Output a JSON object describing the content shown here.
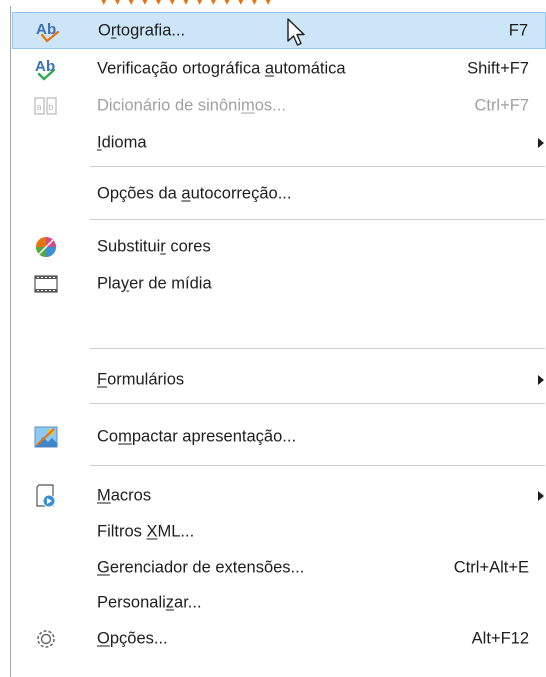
{
  "menu": {
    "items": [
      {
        "label_pre": "O",
        "label_u": "r",
        "label_post": "tografia...",
        "shortcut": "F7",
        "icon": "spelling-check-icon",
        "highlighted": true,
        "disabled": false
      },
      {
        "label_pre": "Verificação ortográfica ",
        "label_u": "a",
        "label_post": "utomática",
        "shortcut": "Shift+F7",
        "icon": "auto-spellcheck-icon",
        "disabled": false
      },
      {
        "label_pre": "Dicionário de sinôni",
        "label_u": "m",
        "label_post": "os...",
        "shortcut": "Ctrl+F7",
        "icon": "thesaurus-icon",
        "disabled": true
      },
      {
        "label_pre": "",
        "label_u": "I",
        "label_post": "dioma",
        "shortcut": "",
        "icon": "",
        "submenu": true,
        "disabled": false
      },
      {
        "label_pre": "Opções da ",
        "label_u": "a",
        "label_post": "utocorreção...",
        "shortcut": "",
        "icon": "",
        "disabled": false
      },
      {
        "label_pre": "Substitui",
        "label_u": "r",
        "label_post": " cores",
        "shortcut": "",
        "icon": "color-replacer-icon",
        "disabled": false
      },
      {
        "label_pre": "Pla",
        "label_u": "y",
        "label_post": "er de mídia",
        "shortcut": "",
        "icon": "media-player-icon",
        "disabled": false
      },
      {
        "label_pre": "",
        "label_u": "F",
        "label_post": "ormulários",
        "shortcut": "",
        "icon": "",
        "submenu": true,
        "disabled": false
      },
      {
        "label_pre": "Co",
        "label_u": "m",
        "label_post": "pactar apresentação...",
        "shortcut": "",
        "icon": "compress-presentation-icon",
        "disabled": false
      },
      {
        "label_pre": "",
        "label_u": "M",
        "label_post": "acros",
        "shortcut": "",
        "icon": "macros-icon",
        "submenu": true,
        "disabled": false
      },
      {
        "label_pre": "Filtros ",
        "label_u": "X",
        "label_post": "ML...",
        "shortcut": "",
        "icon": "",
        "disabled": false
      },
      {
        "label_pre": "",
        "label_u": "G",
        "label_post": "erenciador de extensões...",
        "shortcut": "Ctrl+Alt+E",
        "icon": "",
        "disabled": false
      },
      {
        "label_pre": "Personali",
        "label_u": "z",
        "label_post": "ar...",
        "shortcut": "",
        "icon": "",
        "disabled": false
      },
      {
        "label_pre": "",
        "label_u": "O",
        "label_post": "pções...",
        "shortcut": "Alt+F12",
        "icon": "options-gear-icon",
        "disabled": false
      }
    ]
  },
  "colors": {
    "highlight_bg": "#cde6f7",
    "highlight_border": "#90c8f6",
    "disabled_text": "#a0a0a0",
    "separator": "#cfcfcf",
    "top_strip_accent": "#e8720c"
  }
}
